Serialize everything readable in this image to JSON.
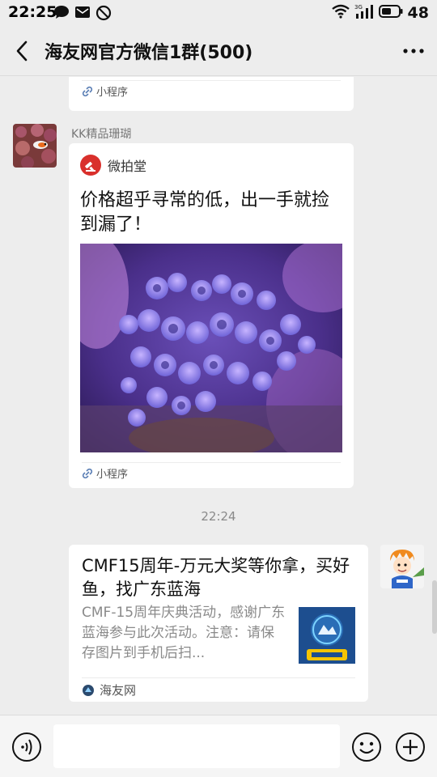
{
  "status_bar": {
    "time": "22:25",
    "battery": "48",
    "network": "3G",
    "icons": [
      "message-bubble-icon",
      "mail-icon",
      "no-disturb-icon",
      "wifi-icon",
      "signal-icon",
      "battery-icon"
    ]
  },
  "header": {
    "title": "海友网官方微信1群(500)",
    "back_icon": "chevron-left-icon",
    "more_icon": "more-dots-icon"
  },
  "messages": {
    "top_card": {
      "footer_label": "小程序"
    },
    "mini_program": {
      "sender": "KK精品珊瑚",
      "source_name": "微拍堂",
      "title": "价格超乎寻常的低，出一手就捡到漏了！",
      "footer_label": "小程序"
    },
    "timestamp": "22:24",
    "link_card": {
      "title": "CMF15周年-万元大奖等你拿，买好鱼，找广东蓝海",
      "description": "CMF-15周年庆典活动，感谢广东蓝海参与此次活动。注意：请保存图片到手机后扫...",
      "source": "海友网"
    }
  },
  "input_bar": {
    "placeholder": "",
    "icons": [
      "voice-icon",
      "emoji-icon",
      "plus-icon"
    ]
  },
  "colors": {
    "background": "#ededed",
    "bubble": "#ffffff",
    "mp_logo": "#d9302c",
    "muted_text": "#8a8a8a"
  }
}
